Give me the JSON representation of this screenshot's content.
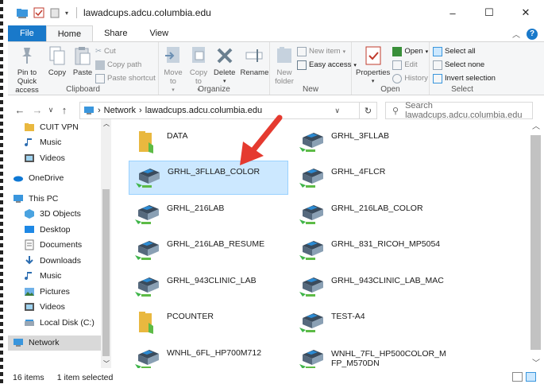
{
  "window": {
    "title": "lawadcups.adcu.columbia.edu",
    "minimize": "–",
    "maximize": "☐",
    "close": "✕"
  },
  "tabs": [
    {
      "label": "File"
    },
    {
      "label": "Home"
    },
    {
      "label": "Share"
    },
    {
      "label": "View"
    }
  ],
  "help_label": "?",
  "ribbon": {
    "clipboard": {
      "label": "Clipboard",
      "pin": "Pin to Quick access",
      "copy": "Copy",
      "paste": "Paste",
      "cut": "Cut",
      "copy_path": "Copy path",
      "paste_shortcut": "Paste shortcut"
    },
    "organize": {
      "label": "Organize",
      "move_to": "Move to",
      "copy_to": "Copy to",
      "delete": "Delete",
      "rename": "Rename"
    },
    "new": {
      "label": "New",
      "new_folder": "New folder",
      "new_item": "New item",
      "easy_access": "Easy access"
    },
    "open": {
      "label": "Open",
      "properties": "Properties",
      "open": "Open",
      "edit": "Edit",
      "history": "History"
    },
    "select": {
      "label": "Select",
      "select_all": "Select all",
      "select_none": "Select none",
      "invert": "Invert selection"
    }
  },
  "address": {
    "crumbs": [
      "Network",
      "lawadcups.adcu.columbia.edu"
    ],
    "search_placeholder": "Search lawadcups.adcu.columbia.edu"
  },
  "nav": [
    {
      "label": "CUIT VPN",
      "icon": "folder-icon"
    },
    {
      "label": "Music",
      "icon": "music-icon"
    },
    {
      "label": "Videos",
      "icon": "videos-icon"
    },
    {
      "label": "OneDrive",
      "icon": "onedrive-icon"
    },
    {
      "label": "This PC",
      "icon": "pc-icon"
    },
    {
      "label": "3D Objects",
      "icon": "3d-objects-icon"
    },
    {
      "label": "Desktop",
      "icon": "desktop-icon"
    },
    {
      "label": "Documents",
      "icon": "documents-icon"
    },
    {
      "label": "Downloads",
      "icon": "downloads-icon"
    },
    {
      "label": "Music",
      "icon": "music-icon"
    },
    {
      "label": "Pictures",
      "icon": "pictures-icon"
    },
    {
      "label": "Videos",
      "icon": "videos-icon"
    },
    {
      "label": "Local Disk (C:)",
      "icon": "drive-icon"
    },
    {
      "label": "Network",
      "icon": "network-icon"
    }
  ],
  "items": [
    {
      "label": "DATA",
      "type": "folder"
    },
    {
      "label": "GRHL_3FLLAB",
      "type": "printer"
    },
    {
      "label": "GRHL_3FLLAB_COLOR",
      "type": "printer",
      "selected": true
    },
    {
      "label": "GRHL_4FLCR",
      "type": "printer"
    },
    {
      "label": "GRHL_216LAB",
      "type": "printer"
    },
    {
      "label": "GRHL_216LAB_COLOR",
      "type": "printer"
    },
    {
      "label": "GRHL_216LAB_RESUME",
      "type": "printer"
    },
    {
      "label": "GRHL_831_RICOH_MP5054",
      "type": "printer"
    },
    {
      "label": "GRHL_943CLINIC_LAB",
      "type": "printer"
    },
    {
      "label": "GRHL_943CLINIC_LAB_MAC",
      "type": "printer"
    },
    {
      "label": "PCOUNTER",
      "type": "folder"
    },
    {
      "label": "TEST-A4",
      "type": "printer"
    },
    {
      "label": "WNHL_6FL_HP700M712",
      "type": "printer"
    },
    {
      "label": "WNHL_7FL_HP500COLOR_MFP_M570DN",
      "type": "printer"
    }
  ],
  "status": {
    "count": "16 items",
    "selected": "1 item selected"
  },
  "colors": {
    "accent": "#1979ca",
    "selection": "#cce8ff",
    "arrow": "#e53a2f"
  }
}
